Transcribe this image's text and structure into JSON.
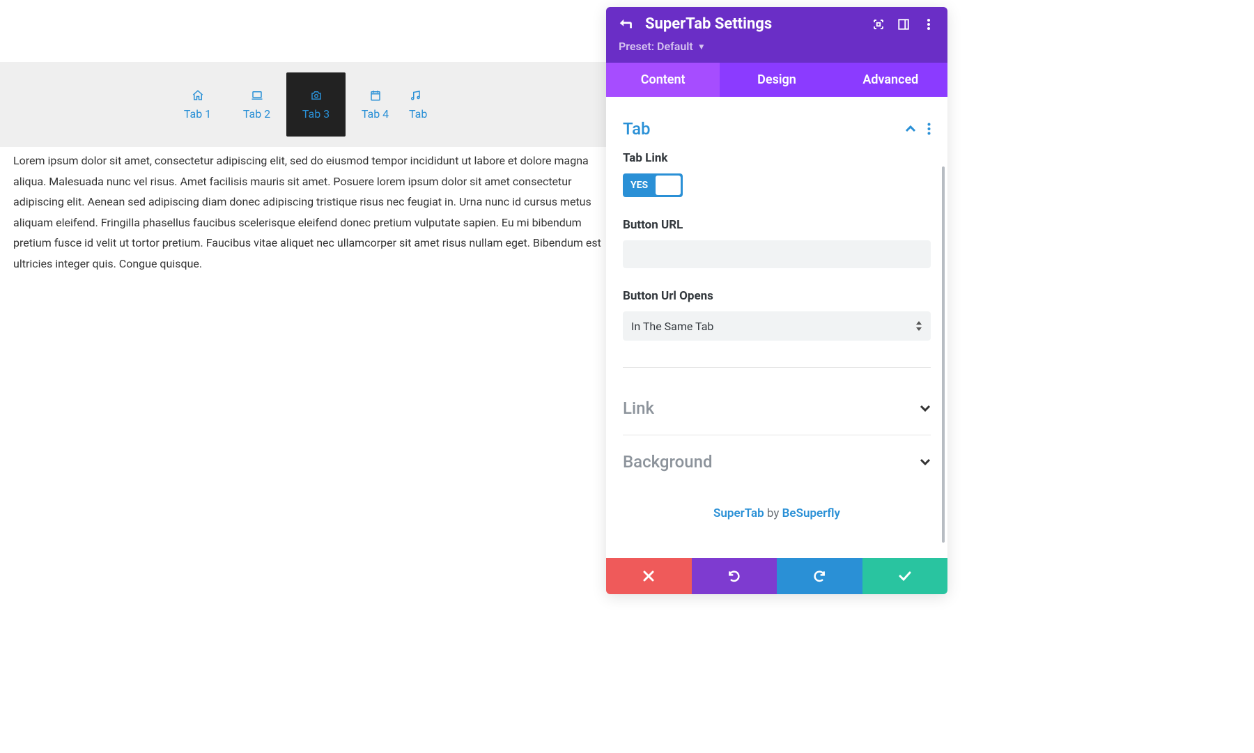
{
  "tabs": {
    "items": [
      {
        "label": "Tab 1",
        "icon": "home-icon"
      },
      {
        "label": "Tab 2",
        "icon": "laptop-icon"
      },
      {
        "label": "Tab 3",
        "icon": "camera-icon"
      },
      {
        "label": "Tab 4",
        "icon": "calendar-icon"
      },
      {
        "label": "Tab",
        "icon": "music-icon"
      }
    ],
    "active_index": 2
  },
  "content_text": "Lorem ipsum dolor sit amet, consectetur adipiscing elit, sed do eiusmod tempor incididunt ut labore et dolore magna aliqua. Malesuada nunc vel risus. Amet facilisis mauris sit amet. Posuere lorem ipsum dolor sit amet consectetur adipiscing elit. Aenean sed adipiscing diam donec adipiscing tristique risus nec feugiat in. Urna nunc id cursus metus aliquam eleifend. Fringilla phasellus faucibus scelerisque eleifend donec pretium vulputate sapien. Eu mi bibendum pretium fusce id velit ut tortor pretium. Faucibus vitae aliquet nec ullamcorper sit amet risus nullam eget. Bibendum est ultricies integer quis. Congue quisque.",
  "panel": {
    "title": "SuperTab Settings",
    "preset_label": "Preset: Default",
    "tabs": {
      "content": "Content",
      "design": "Design",
      "advanced": "Advanced",
      "active": "content"
    },
    "sections": {
      "tab": {
        "title": "Tab",
        "fields": {
          "tab_link": {
            "label": "Tab Link",
            "value_label": "YES",
            "value": true
          },
          "button_url": {
            "label": "Button URL",
            "value": ""
          },
          "url_opens": {
            "label": "Button Url Opens",
            "selected": "In The Same Tab"
          }
        }
      },
      "link": {
        "title": "Link"
      },
      "background": {
        "title": "Background"
      }
    },
    "credit": {
      "product": "SuperTab",
      "middle": " by ",
      "author": "BeSuperfly"
    }
  }
}
